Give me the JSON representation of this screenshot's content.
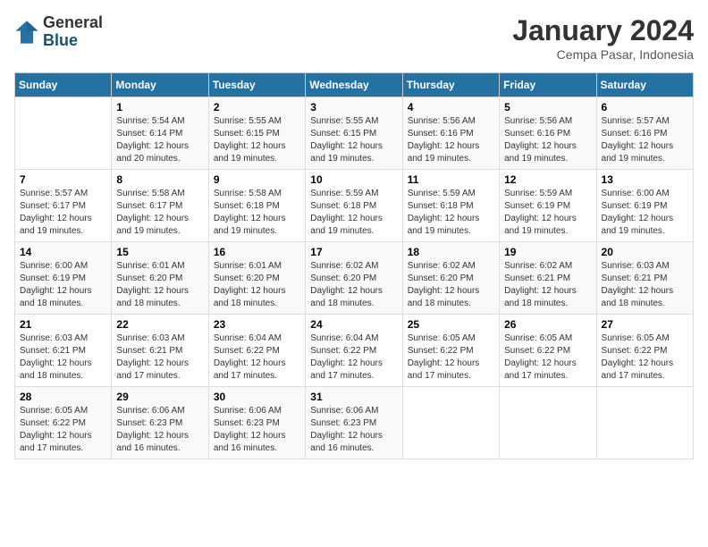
{
  "header": {
    "logo_general": "General",
    "logo_blue": "Blue",
    "title": "January 2024",
    "subtitle": "Cempa Pasar, Indonesia"
  },
  "columns": [
    "Sunday",
    "Monday",
    "Tuesday",
    "Wednesday",
    "Thursday",
    "Friday",
    "Saturday"
  ],
  "weeks": [
    [
      {
        "day": "",
        "info": ""
      },
      {
        "day": "1",
        "info": "Sunrise: 5:54 AM\nSunset: 6:14 PM\nDaylight: 12 hours\nand 20 minutes."
      },
      {
        "day": "2",
        "info": "Sunrise: 5:55 AM\nSunset: 6:15 PM\nDaylight: 12 hours\nand 19 minutes."
      },
      {
        "day": "3",
        "info": "Sunrise: 5:55 AM\nSunset: 6:15 PM\nDaylight: 12 hours\nand 19 minutes."
      },
      {
        "day": "4",
        "info": "Sunrise: 5:56 AM\nSunset: 6:16 PM\nDaylight: 12 hours\nand 19 minutes."
      },
      {
        "day": "5",
        "info": "Sunrise: 5:56 AM\nSunset: 6:16 PM\nDaylight: 12 hours\nand 19 minutes."
      },
      {
        "day": "6",
        "info": "Sunrise: 5:57 AM\nSunset: 6:16 PM\nDaylight: 12 hours\nand 19 minutes."
      }
    ],
    [
      {
        "day": "7",
        "info": "Sunrise: 5:57 AM\nSunset: 6:17 PM\nDaylight: 12 hours\nand 19 minutes."
      },
      {
        "day": "8",
        "info": "Sunrise: 5:58 AM\nSunset: 6:17 PM\nDaylight: 12 hours\nand 19 minutes."
      },
      {
        "day": "9",
        "info": "Sunrise: 5:58 AM\nSunset: 6:18 PM\nDaylight: 12 hours\nand 19 minutes."
      },
      {
        "day": "10",
        "info": "Sunrise: 5:59 AM\nSunset: 6:18 PM\nDaylight: 12 hours\nand 19 minutes."
      },
      {
        "day": "11",
        "info": "Sunrise: 5:59 AM\nSunset: 6:18 PM\nDaylight: 12 hours\nand 19 minutes."
      },
      {
        "day": "12",
        "info": "Sunrise: 5:59 AM\nSunset: 6:19 PM\nDaylight: 12 hours\nand 19 minutes."
      },
      {
        "day": "13",
        "info": "Sunrise: 6:00 AM\nSunset: 6:19 PM\nDaylight: 12 hours\nand 19 minutes."
      }
    ],
    [
      {
        "day": "14",
        "info": "Sunrise: 6:00 AM\nSunset: 6:19 PM\nDaylight: 12 hours\nand 18 minutes."
      },
      {
        "day": "15",
        "info": "Sunrise: 6:01 AM\nSunset: 6:20 PM\nDaylight: 12 hours\nand 18 minutes."
      },
      {
        "day": "16",
        "info": "Sunrise: 6:01 AM\nSunset: 6:20 PM\nDaylight: 12 hours\nand 18 minutes."
      },
      {
        "day": "17",
        "info": "Sunrise: 6:02 AM\nSunset: 6:20 PM\nDaylight: 12 hours\nand 18 minutes."
      },
      {
        "day": "18",
        "info": "Sunrise: 6:02 AM\nSunset: 6:20 PM\nDaylight: 12 hours\nand 18 minutes."
      },
      {
        "day": "19",
        "info": "Sunrise: 6:02 AM\nSunset: 6:21 PM\nDaylight: 12 hours\nand 18 minutes."
      },
      {
        "day": "20",
        "info": "Sunrise: 6:03 AM\nSunset: 6:21 PM\nDaylight: 12 hours\nand 18 minutes."
      }
    ],
    [
      {
        "day": "21",
        "info": "Sunrise: 6:03 AM\nSunset: 6:21 PM\nDaylight: 12 hours\nand 18 minutes."
      },
      {
        "day": "22",
        "info": "Sunrise: 6:03 AM\nSunset: 6:21 PM\nDaylight: 12 hours\nand 17 minutes."
      },
      {
        "day": "23",
        "info": "Sunrise: 6:04 AM\nSunset: 6:22 PM\nDaylight: 12 hours\nand 17 minutes."
      },
      {
        "day": "24",
        "info": "Sunrise: 6:04 AM\nSunset: 6:22 PM\nDaylight: 12 hours\nand 17 minutes."
      },
      {
        "day": "25",
        "info": "Sunrise: 6:05 AM\nSunset: 6:22 PM\nDaylight: 12 hours\nand 17 minutes."
      },
      {
        "day": "26",
        "info": "Sunrise: 6:05 AM\nSunset: 6:22 PM\nDaylight: 12 hours\nand 17 minutes."
      },
      {
        "day": "27",
        "info": "Sunrise: 6:05 AM\nSunset: 6:22 PM\nDaylight: 12 hours\nand 17 minutes."
      }
    ],
    [
      {
        "day": "28",
        "info": "Sunrise: 6:05 AM\nSunset: 6:22 PM\nDaylight: 12 hours\nand 17 minutes."
      },
      {
        "day": "29",
        "info": "Sunrise: 6:06 AM\nSunset: 6:23 PM\nDaylight: 12 hours\nand 16 minutes."
      },
      {
        "day": "30",
        "info": "Sunrise: 6:06 AM\nSunset: 6:23 PM\nDaylight: 12 hours\nand 16 minutes."
      },
      {
        "day": "31",
        "info": "Sunrise: 6:06 AM\nSunset: 6:23 PM\nDaylight: 12 hours\nand 16 minutes."
      },
      {
        "day": "",
        "info": ""
      },
      {
        "day": "",
        "info": ""
      },
      {
        "day": "",
        "info": ""
      }
    ]
  ]
}
